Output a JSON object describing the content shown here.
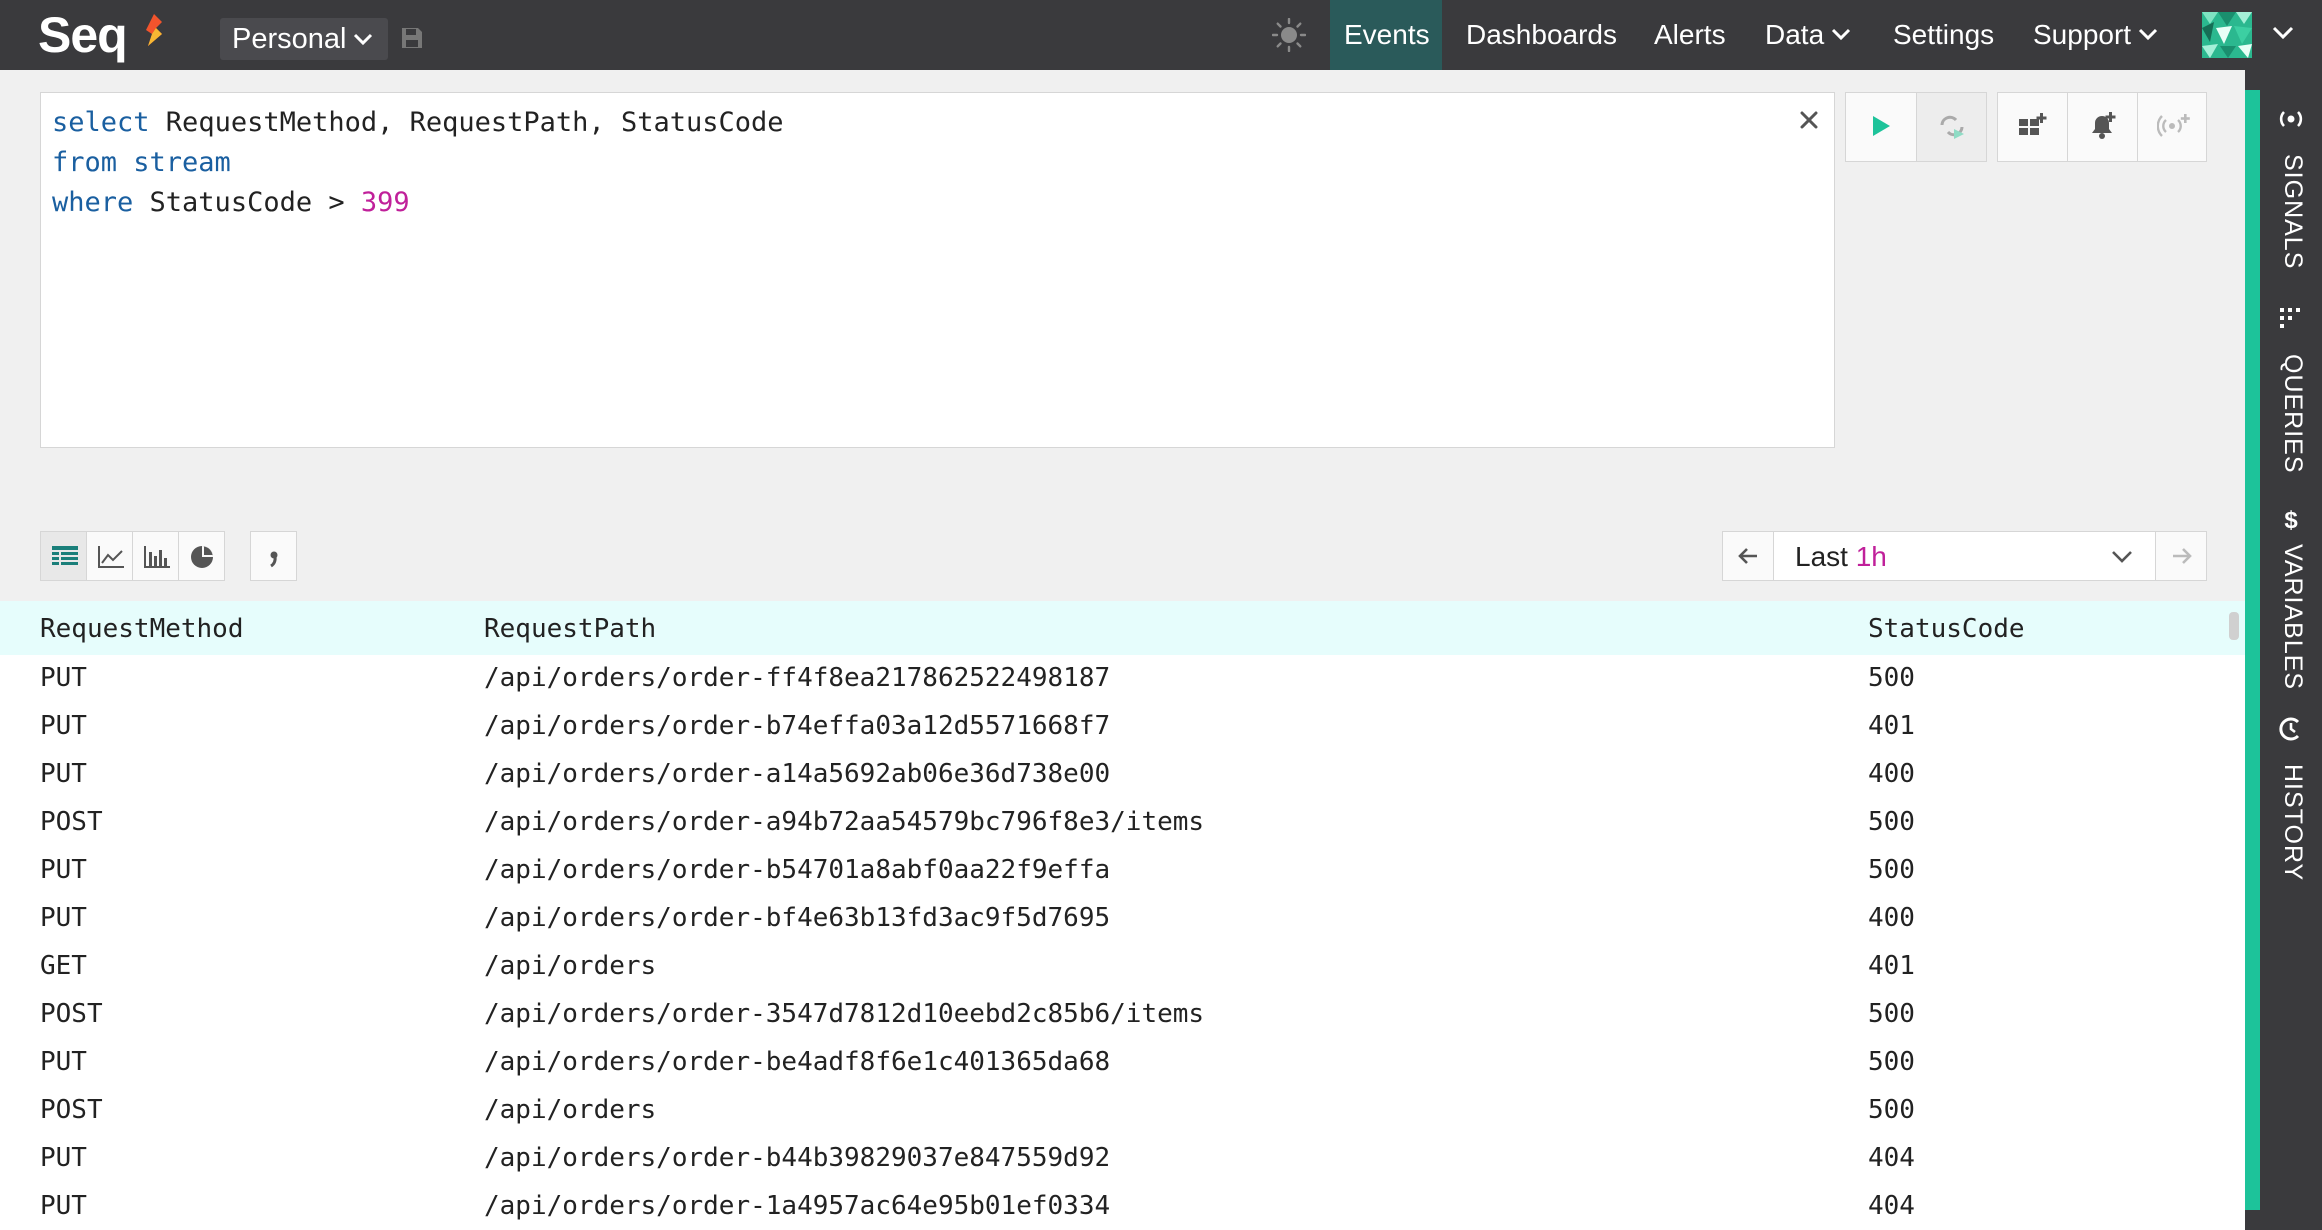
{
  "app": {
    "logo_text": "Seq"
  },
  "header": {
    "workspace": "Personal",
    "nav": [
      {
        "id": "events",
        "label": "Events",
        "active": true
      },
      {
        "id": "dashboards",
        "label": "Dashboards"
      },
      {
        "id": "alerts",
        "label": "Alerts"
      },
      {
        "id": "data",
        "label": "Data"
      },
      {
        "id": "settings",
        "label": "Settings"
      },
      {
        "id": "support",
        "label": "Support"
      }
    ]
  },
  "query": {
    "line1_kw": "select",
    "line1_rest": " RequestMethod, RequestPath, StatusCode",
    "line2_kw": "from stream",
    "line3_kw": "where",
    "line3_rest": " StatusCode > ",
    "line3_num": "399"
  },
  "range": {
    "prefix": "Last ",
    "value": "1h"
  },
  "sidebar": {
    "tabs": [
      {
        "id": "signals",
        "label": "SIGNALS"
      },
      {
        "id": "queries",
        "label": "QUERIES"
      },
      {
        "id": "variables",
        "label": "VARIABLES"
      },
      {
        "id": "history",
        "label": "HISTORY"
      }
    ]
  },
  "results": {
    "columns": [
      "RequestMethod",
      "RequestPath",
      "StatusCode"
    ],
    "rows": [
      [
        "PUT",
        "/api/orders/order-ff4f8ea217862522498187",
        "500"
      ],
      [
        "PUT",
        "/api/orders/order-b74effa03a12d5571668f7",
        "401"
      ],
      [
        "PUT",
        "/api/orders/order-a14a5692ab06e36d738e00",
        "400"
      ],
      [
        "POST",
        "/api/orders/order-a94b72aa54579bc796f8e3/items",
        "500"
      ],
      [
        "PUT",
        "/api/orders/order-b54701a8abf0aa22f9effa",
        "500"
      ],
      [
        "PUT",
        "/api/orders/order-bf4e63b13fd3ac9f5d7695",
        "400"
      ],
      [
        "GET",
        "/api/orders",
        "401"
      ],
      [
        "POST",
        "/api/orders/order-3547d7812d10eebd2c85b6/items",
        "500"
      ],
      [
        "PUT",
        "/api/orders/order-be4adf8f6e1c401365da68",
        "500"
      ],
      [
        "POST",
        "/api/orders",
        "500"
      ],
      [
        "PUT",
        "/api/orders/order-b44b39829037e847559d92",
        "404"
      ],
      [
        "PUT",
        "/api/orders/order-1a4957ac64e95b01ef0334",
        "404"
      ]
    ]
  },
  "colors": {
    "accent": "#1dc39a",
    "highlight": "#c0209a",
    "topbar": "#3a3a3d",
    "header_row": "#e6fdfc"
  }
}
